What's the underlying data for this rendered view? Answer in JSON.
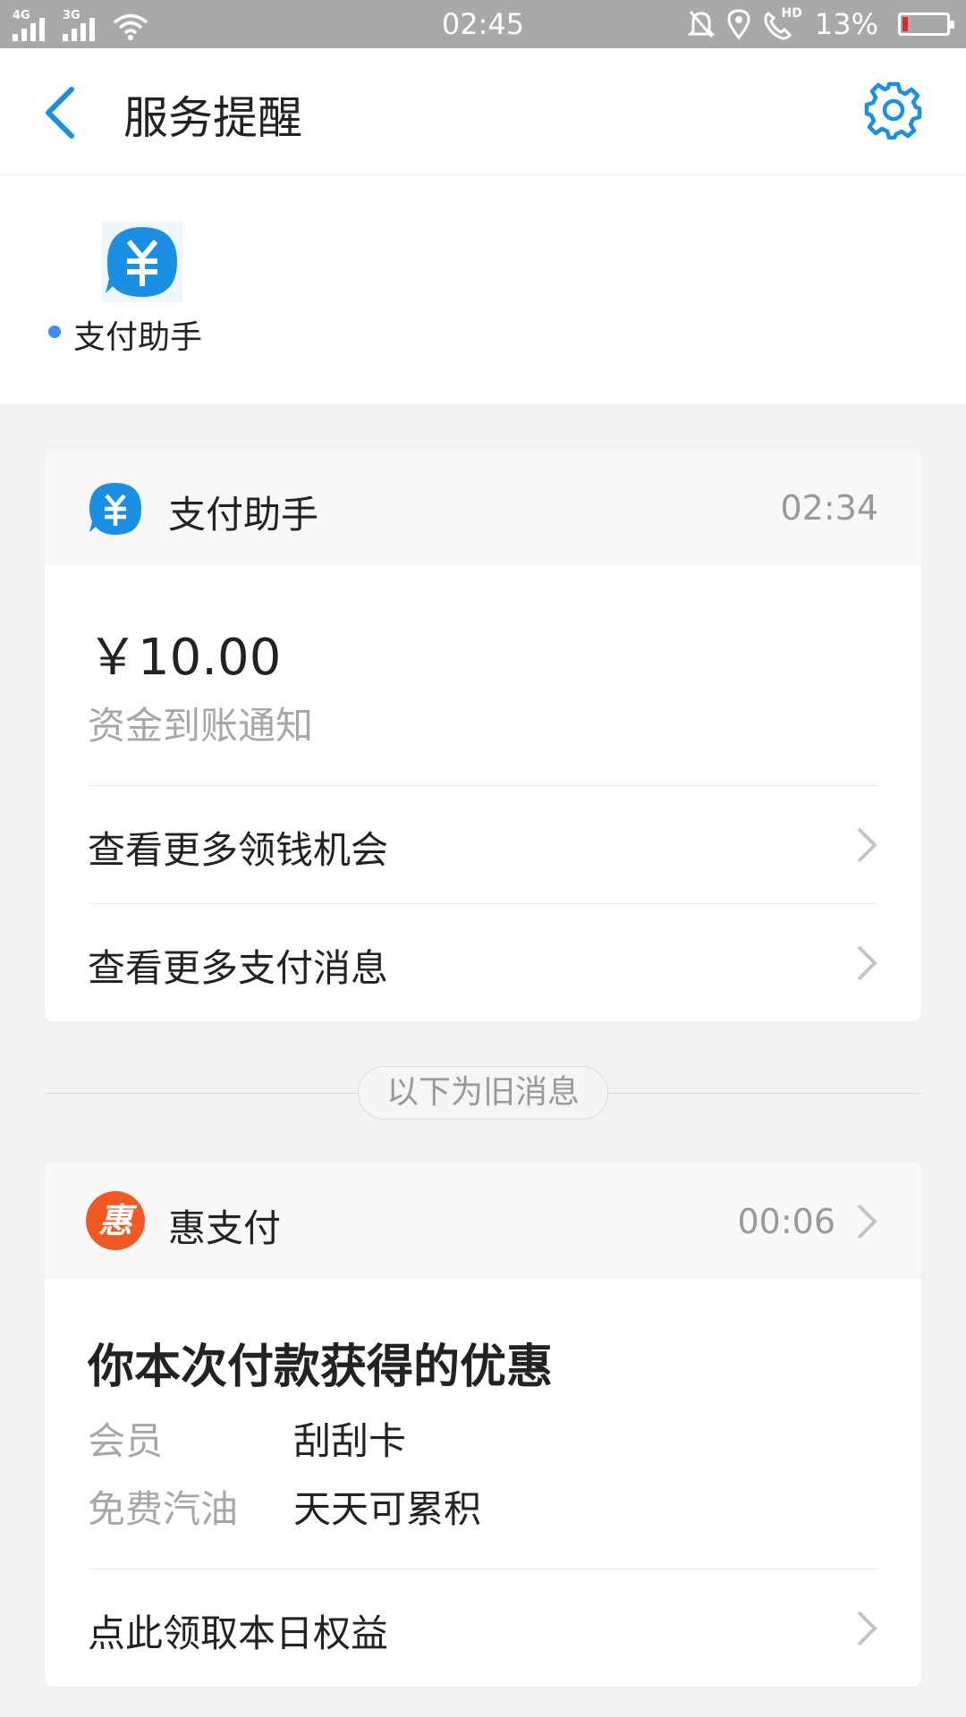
{
  "status_bar": {
    "network_1": "4G",
    "network_2": "3G",
    "time": "02:45",
    "battery_text": "13%",
    "battery_level": 0.13,
    "hd_label": "HD",
    "icons": [
      "signal-icon",
      "wifi-icon",
      "mute-bell-icon",
      "location-icon",
      "hd-call-icon",
      "battery-icon"
    ]
  },
  "header": {
    "title": "服务提醒",
    "accent_color": "#1a8fe3"
  },
  "service_strip": {
    "label": "支付助手",
    "icon": "yuan-chat-icon"
  },
  "cards": {
    "payment": {
      "name": "支付助手",
      "time": "02:34",
      "amount": "￥10.00",
      "amount_desc": "资金到账通知",
      "links": [
        "查看更多领钱机会",
        "查看更多支付消息"
      ]
    },
    "old_divider": "以下为旧消息",
    "promo": {
      "name": "惠支付",
      "badge_char": "惠",
      "badge_color": "#f05a22",
      "time": "00:06",
      "title": "你本次付款获得的优惠",
      "items": [
        {
          "key": "会员",
          "value": "刮刮卡"
        },
        {
          "key": "免费汽油",
          "value": "天天可累积"
        }
      ],
      "link": "点此领取本日权益"
    }
  }
}
